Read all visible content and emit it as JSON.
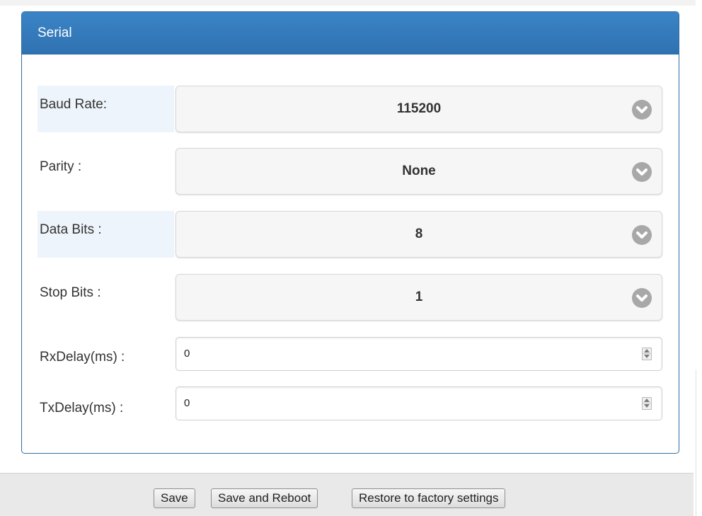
{
  "panel": {
    "title": "Serial"
  },
  "fields": {
    "baud_rate": {
      "label": "Baud Rate:",
      "value": "115200"
    },
    "parity": {
      "label": "Parity :",
      "value": "None"
    },
    "data_bits": {
      "label": "Data Bits :",
      "value": "8"
    },
    "stop_bits": {
      "label": "Stop Bits :",
      "value": "1"
    },
    "rx_delay": {
      "label": "RxDelay(ms) :",
      "value": "0"
    },
    "tx_delay": {
      "label": "TxDelay(ms) :",
      "value": "0"
    }
  },
  "footer": {
    "save_label": "Save",
    "save_reboot_label": "Save and Reboot",
    "restore_label": "Restore to factory settings"
  },
  "icons": {
    "select_arrow": "chevron-down-icon",
    "number_spinner": "spinner-icon"
  },
  "colors": {
    "panel_header": "#337ab7",
    "panel_border": "#2e6da4",
    "label_highlight": "#eef4fb",
    "select_background": "#f6f6f6",
    "chevron_circle": "#a8a8a8",
    "footer_background": "#e9e9e9"
  }
}
